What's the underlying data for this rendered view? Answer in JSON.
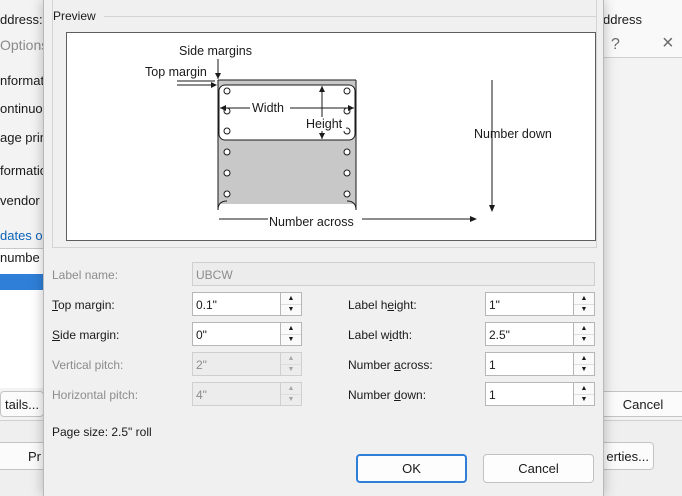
{
  "background": {
    "left_texts": [
      "ddress:",
      "Options",
      "nformat",
      "ontinuo",
      "age prin",
      "formatio",
      "vendor",
      "dates or",
      "numbe"
    ],
    "right_title_text": "ddress",
    "right_icons": [
      "?",
      "×"
    ],
    "left_button": "tails...",
    "right_cancel": "Cancel",
    "bottom_left_button": "Pr",
    "bottom_right_button": "erties..."
  },
  "dialog": {
    "preview": {
      "title": "Preview",
      "diagram": {
        "side_margins": "Side margins",
        "top_margin": "Top margin",
        "width": "Width",
        "height": "Height",
        "number_down": "Number down",
        "number_across": "Number across"
      }
    },
    "label_name": {
      "label": "Label name:",
      "value": "UBCW"
    },
    "fields": {
      "top_margin": {
        "label_pre": "",
        "label_u": "T",
        "label_post": "op margin:",
        "value": "0.1\""
      },
      "side_margin": {
        "label_pre": "",
        "label_u": "S",
        "label_post": "ide margin:",
        "value": "0\""
      },
      "vertical_pitch": {
        "label": "Vertical pitch:",
        "value": "2\""
      },
      "horizontal_pitch": {
        "label": "Horizontal pitch:",
        "value": "4\""
      },
      "label_height": {
        "label_pre": "Label h",
        "label_u": "e",
        "label_post": "ight:",
        "value": "1\""
      },
      "label_width": {
        "label_pre": "Label w",
        "label_u": "i",
        "label_post": "dth:",
        "value": "2.5\""
      },
      "number_across": {
        "label_pre": "Number ",
        "label_u": "a",
        "label_post": "cross:",
        "value": "1"
      },
      "number_down": {
        "label_pre": "Number ",
        "label_u": "d",
        "label_post": "own:",
        "value": "1"
      }
    },
    "page_size": "Page size: 2.5\" roll",
    "buttons": {
      "ok": "OK",
      "cancel": "Cancel"
    },
    "spin_up": "▲",
    "spin_down": "▼"
  },
  "colors": {
    "accent": "#2f7fd8",
    "dialog_bg": "#f0f0f0",
    "label_gray": "#c8c8c8"
  }
}
